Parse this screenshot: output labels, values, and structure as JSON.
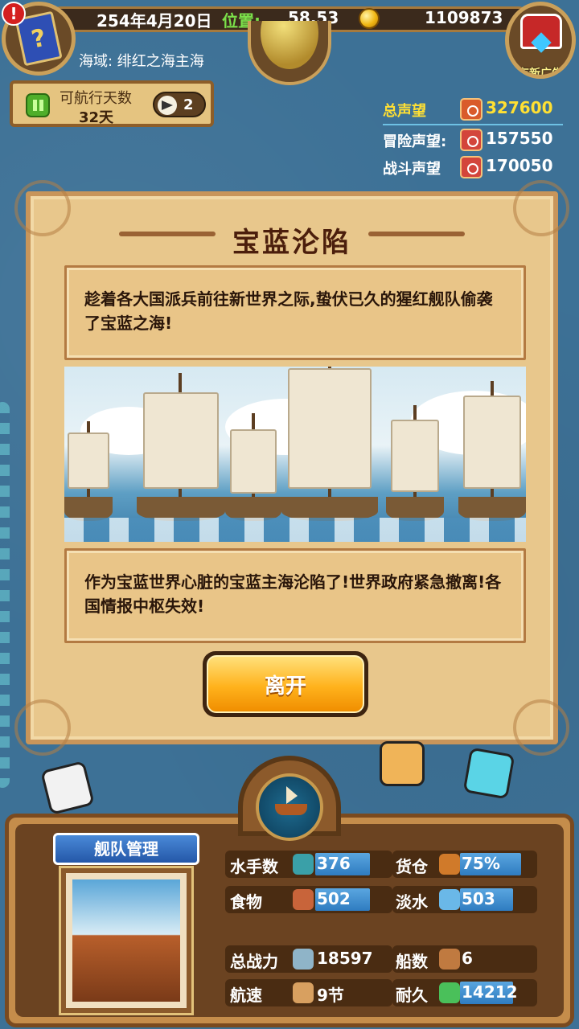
{
  "topbar": {
    "date": "254年4月20日",
    "position_label": "位置:",
    "position_value": "58,53",
    "gold": "1109873",
    "region": "海域: 绯红之海主海",
    "alert": "!",
    "book_glyph": "?"
  },
  "ad": {
    "label": "有新广告"
  },
  "sailing": {
    "title": "可航行天数",
    "days": "32天",
    "compass_count": "2"
  },
  "reputation": {
    "total_label": "总声望",
    "total_value": "327600",
    "adventure_label": "冒险声望:",
    "adventure_value": "157550",
    "battle_label": "战斗声望",
    "battle_value": "170050"
  },
  "event": {
    "title": "宝蓝沦陷",
    "text1": "趁着各大国派兵前往新世界之际,蛰伏已久的猩红舰队偷袭了宝蓝之海!",
    "text2": "作为宝蓝世界心脏的宝蓝主海沦陷了!世界政府紧急撤离!各国情报中枢失效!",
    "leave_label": "离开"
  },
  "fleet": {
    "title": "舰队管理",
    "stats": [
      {
        "label": "水手数",
        "value": "376",
        "fill": 0.55
      },
      {
        "label": "货仓",
        "value": "75%",
        "fill": 0.75
      },
      {
        "label": "食物",
        "value": "502",
        "fill": 0.55
      },
      {
        "label": "淡水",
        "value": "503",
        "fill": 0.7
      },
      {
        "label": "总战力",
        "value": "18597",
        "fill": 0
      },
      {
        "label": "船数",
        "value": "6",
        "fill": 0
      },
      {
        "label": "航速",
        "value": "9节",
        "fill": 0
      },
      {
        "label": "耐久",
        "value": "14212",
        "fill": 0.7
      }
    ]
  },
  "colors": {
    "accent_green": "#7be04a",
    "gold_text": "#fff38a",
    "reputation_total": "#ffe033"
  }
}
